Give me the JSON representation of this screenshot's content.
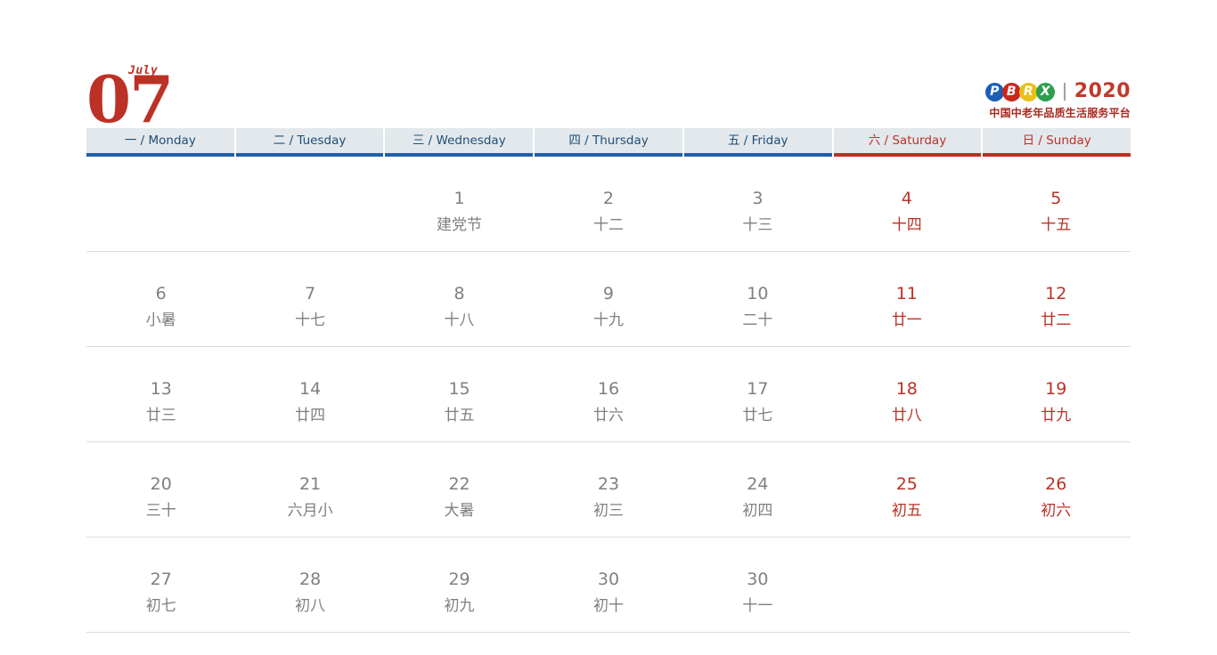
{
  "header": {
    "month_number": "07",
    "month_label": "July",
    "brand": {
      "logo_letters": [
        "P",
        "B",
        "R",
        "X"
      ],
      "logo_colors": [
        "#1a5fb4",
        "#c9281e",
        "#e8c01a",
        "#2e9e4f"
      ],
      "year": "2020",
      "tagline": "中国中老年品质生活服务平台"
    }
  },
  "weekdays": [
    {
      "label": "一 / Monday",
      "weekend": false
    },
    {
      "label": "二 / Tuesday",
      "weekend": false
    },
    {
      "label": "三 / Wednesday",
      "weekend": false
    },
    {
      "label": "四 / Thursday",
      "weekend": false
    },
    {
      "label": "五 / Friday",
      "weekend": false
    },
    {
      "label": "六 / Saturday",
      "weekend": true
    },
    {
      "label": "日 / Sunday",
      "weekend": true
    }
  ],
  "colors": {
    "accent_red": "#bc3126",
    "accent_blue": "#1f4e79",
    "header_bg": "#e2e8ec",
    "day_gray": "#808080",
    "rule_gray": "#dcdcdc"
  },
  "weeks": [
    [
      {
        "day": "",
        "lunar": "",
        "empty": true
      },
      {
        "day": "",
        "lunar": "",
        "empty": true
      },
      {
        "day": "1",
        "lunar": "建党节",
        "empty": false
      },
      {
        "day": "2",
        "lunar": "十二",
        "empty": false
      },
      {
        "day": "3",
        "lunar": "十三",
        "empty": false
      },
      {
        "day": "4",
        "lunar": "十四",
        "empty": false
      },
      {
        "day": "5",
        "lunar": "十五",
        "empty": false
      }
    ],
    [
      {
        "day": "6",
        "lunar": "小暑",
        "empty": false
      },
      {
        "day": "7",
        "lunar": "十七",
        "empty": false
      },
      {
        "day": "8",
        "lunar": "十八",
        "empty": false
      },
      {
        "day": "9",
        "lunar": "十九",
        "empty": false
      },
      {
        "day": "10",
        "lunar": "二十",
        "empty": false
      },
      {
        "day": "11",
        "lunar": "廿一",
        "empty": false
      },
      {
        "day": "12",
        "lunar": "廿二",
        "empty": false
      }
    ],
    [
      {
        "day": "13",
        "lunar": "廿三",
        "empty": false
      },
      {
        "day": "14",
        "lunar": "廿四",
        "empty": false
      },
      {
        "day": "15",
        "lunar": "廿五",
        "empty": false
      },
      {
        "day": "16",
        "lunar": "廿六",
        "empty": false
      },
      {
        "day": "17",
        "lunar": "廿七",
        "empty": false
      },
      {
        "day": "18",
        "lunar": "廿八",
        "empty": false
      },
      {
        "day": "19",
        "lunar": "廿九",
        "empty": false
      }
    ],
    [
      {
        "day": "20",
        "lunar": "三十",
        "empty": false
      },
      {
        "day": "21",
        "lunar": "六月小",
        "empty": false
      },
      {
        "day": "22",
        "lunar": "大暑",
        "empty": false
      },
      {
        "day": "23",
        "lunar": "初三",
        "empty": false
      },
      {
        "day": "24",
        "lunar": "初四",
        "empty": false
      },
      {
        "day": "25",
        "lunar": "初五",
        "empty": false
      },
      {
        "day": "26",
        "lunar": "初六",
        "empty": false
      }
    ],
    [
      {
        "day": "27",
        "lunar": "初七",
        "empty": false
      },
      {
        "day": "28",
        "lunar": "初八",
        "empty": false
      },
      {
        "day": "29",
        "lunar": "初九",
        "empty": false
      },
      {
        "day": "30",
        "lunar": "初十",
        "empty": false
      },
      {
        "day": "30",
        "lunar": "十一",
        "empty": false
      },
      {
        "day": "",
        "lunar": "",
        "empty": true
      },
      {
        "day": "",
        "lunar": "",
        "empty": true
      }
    ]
  ]
}
